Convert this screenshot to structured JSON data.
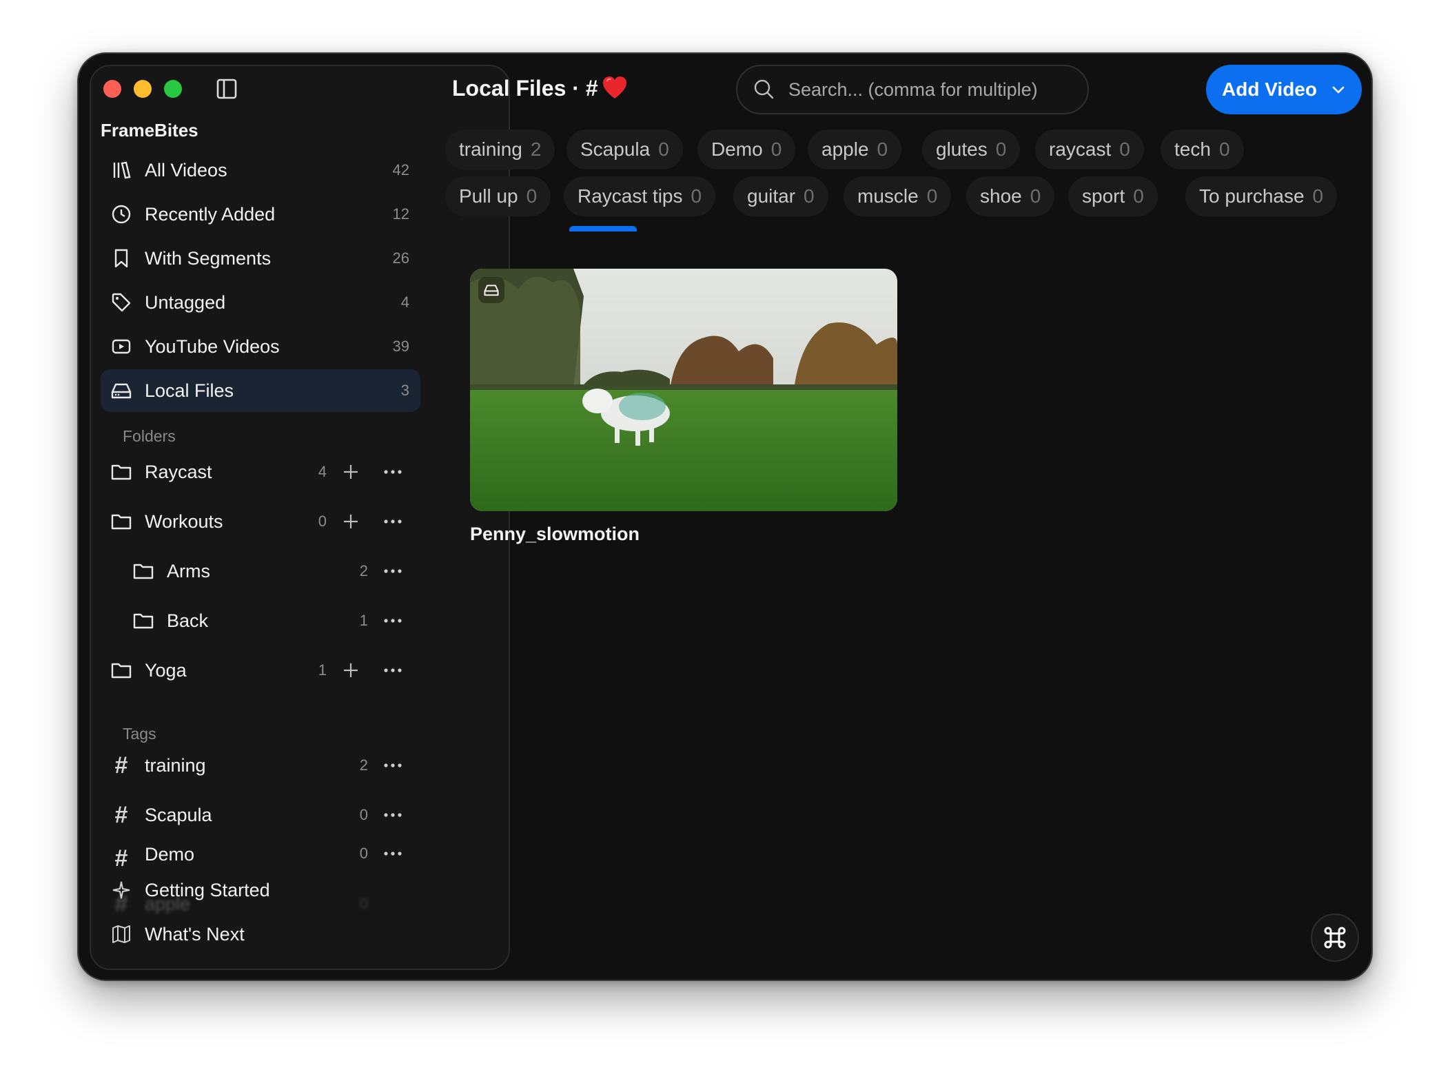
{
  "app": {
    "name": "FrameBites"
  },
  "sidebar": {
    "nav": [
      {
        "label": "All Videos",
        "count": "42",
        "icon": "library-icon"
      },
      {
        "label": "Recently Added",
        "count": "12",
        "icon": "clock-icon"
      },
      {
        "label": "With Segments",
        "count": "26",
        "icon": "bookmark-icon"
      },
      {
        "label": "Untagged",
        "count": "4",
        "icon": "tag-icon"
      },
      {
        "label": "YouTube Videos",
        "count": "39",
        "icon": "youtube-icon"
      },
      {
        "label": "Local Files",
        "count": "3",
        "icon": "drive-icon",
        "active": true
      }
    ],
    "folders_title": "Folders",
    "folders": [
      {
        "label": "Raycast",
        "count": "4"
      },
      {
        "label": "Workouts",
        "count": "0"
      },
      {
        "label": "Arms",
        "count": "2"
      },
      {
        "label": "Back",
        "count": "1"
      },
      {
        "label": "Yoga",
        "count": "1"
      }
    ],
    "tags_title": "Tags",
    "tags": [
      {
        "label": "training",
        "count": "2"
      },
      {
        "label": "Scapula",
        "count": "0"
      },
      {
        "label": "Demo",
        "count": "0"
      },
      {
        "label": "apple",
        "count": "0"
      }
    ],
    "bottom": [
      {
        "label": "Getting Started",
        "icon": "sparkle-icon"
      },
      {
        "label": "What's Next",
        "icon": "map-icon"
      }
    ]
  },
  "header": {
    "title": "Local Files · #",
    "title_emoji": "heart-emoji",
    "search_placeholder": "Search... (comma for multiple)",
    "add_button": "Add Video"
  },
  "chips": [
    {
      "label": "training",
      "count": "2"
    },
    {
      "label": "Scapula",
      "count": "0"
    },
    {
      "label": "Demo",
      "count": "0"
    },
    {
      "label": "apple",
      "count": "0"
    },
    {
      "label": "glutes",
      "count": "0"
    },
    {
      "label": "raycast",
      "count": "0"
    },
    {
      "label": "tech",
      "count": "0"
    },
    {
      "label": "Pull up",
      "count": "0"
    },
    {
      "label": "Raycast tips",
      "count": "0"
    },
    {
      "label": "guitar",
      "count": "0"
    },
    {
      "label": "muscle",
      "count": "0"
    },
    {
      "label": "shoe",
      "count": "0"
    },
    {
      "label": "sport",
      "count": "0"
    },
    {
      "label": "To purchase",
      "count": "0"
    }
  ],
  "videos": [
    {
      "title": "Penny_slowmotion"
    }
  ],
  "colors": {
    "accent": "#0b6ff0",
    "background": "#101010",
    "sidebar": "#161616",
    "active": "#1b2433"
  }
}
